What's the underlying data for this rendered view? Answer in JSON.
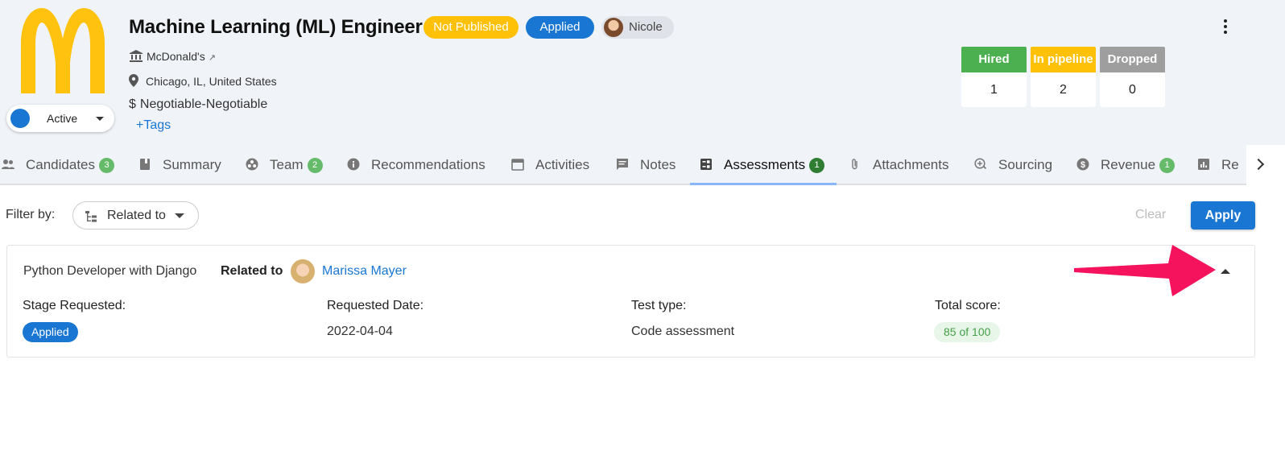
{
  "job": {
    "title": "Machine Learning (ML) Engineer",
    "badge_status": "Not Published",
    "badge_stage": "Applied",
    "owner": "Nicole",
    "company": "McDonald's",
    "location": "Chicago, IL, United States",
    "salary": "Negotiable-Negotiable",
    "tags_link": "+Tags",
    "status": "Active"
  },
  "stats": {
    "hired": {
      "label": "Hired",
      "value": "1"
    },
    "pipeline": {
      "label": "In pipeline",
      "value": "2"
    },
    "dropped": {
      "label": "Dropped",
      "value": "0"
    }
  },
  "tabs": [
    {
      "label": "Candidates",
      "count": "3"
    },
    {
      "label": "Summary"
    },
    {
      "label": "Team",
      "count": "2"
    },
    {
      "label": "Recommendations"
    },
    {
      "label": "Activities"
    },
    {
      "label": "Notes"
    },
    {
      "label": "Assessments",
      "count": "1"
    },
    {
      "label": "Attachments"
    },
    {
      "label": "Sourcing"
    },
    {
      "label": "Revenue",
      "count": "1"
    },
    {
      "label": "Re"
    }
  ],
  "filter": {
    "label": "Filter by:",
    "selected": "Related to",
    "clear": "Clear",
    "apply": "Apply"
  },
  "assessment": {
    "title": "Python Developer with Django",
    "related_label": "Related to",
    "related_person": "Marissa Mayer",
    "stage_label": "Stage Requested:",
    "stage_value": "Applied",
    "date_label": "Requested Date:",
    "date_value": "2022-04-04",
    "test_label": "Test type:",
    "test_value": "Code assessment",
    "score_label": "Total score:",
    "score_value": "85 of 100"
  },
  "colors": {
    "primary": "#1976d2",
    "warning": "#ffc107",
    "success": "#4caf50",
    "muted": "#9e9e9e",
    "annotation_arrow": "#f5135e"
  }
}
